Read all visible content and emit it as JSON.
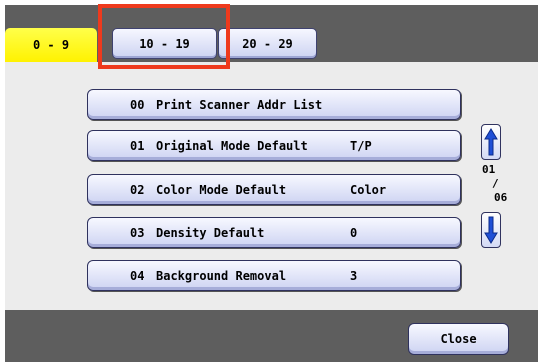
{
  "tabs": [
    {
      "label": "0 - 9",
      "active": true
    },
    {
      "label": "10 - 19",
      "active": false
    },
    {
      "label": "20 - 29",
      "active": false
    }
  ],
  "items": [
    {
      "num": "00",
      "label": "Print Scanner Addr List",
      "value": ""
    },
    {
      "num": "01",
      "label": "Original Mode Default",
      "value": "T/P"
    },
    {
      "num": "02",
      "label": "Color Mode Default",
      "value": "Color"
    },
    {
      "num": "03",
      "label": "Density Default",
      "value": "0"
    },
    {
      "num": "04",
      "label": "Background Removal",
      "value": "3"
    }
  ],
  "pager": {
    "current": "01",
    "separator": "/",
    "total": "06"
  },
  "close_label": "Close",
  "colors": {
    "active_tab": "#fff200",
    "highlight": "#ee3a1d",
    "button_face": "#cdd3f2",
    "arrow_blue": "#1f4fd6"
  },
  "icons": {
    "up": "up-arrow-icon",
    "down": "down-arrow-icon"
  }
}
